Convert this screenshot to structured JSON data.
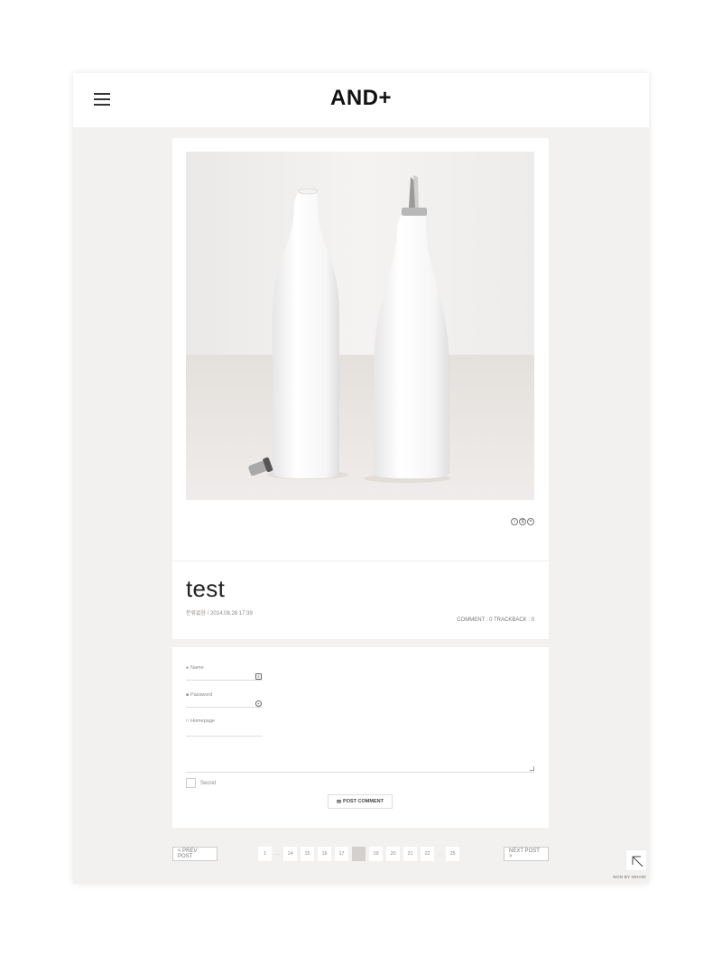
{
  "header": {
    "logo": "AND+"
  },
  "post": {
    "title": "test",
    "category": "분류없음",
    "date": "/ 2014.08.28 17:39",
    "stats": "COMMENT : 0 TRACKBACK : 0",
    "license_icons": [
      "creative-commons-by-icon",
      "creative-commons-nc-icon",
      "creative-commons-nd-icon"
    ]
  },
  "comment_form": {
    "name_label": "Name",
    "password_label": "Password",
    "homepage_label": "Homepage",
    "secret_label": "Secret",
    "submit_label": "POST COMMENT"
  },
  "pager": {
    "prev_label": "< PREV POST",
    "next_label": "NEXT POST >",
    "pages": [
      "1",
      "…",
      "14",
      "15",
      "16",
      "17",
      "18",
      "19",
      "20",
      "21",
      "22",
      "…",
      "25"
    ],
    "current_page": "18"
  },
  "footer": {
    "credit": "SKIN BY ISHAIN"
  },
  "colors": {
    "frame_bg": "#f2f1ef",
    "current_page_bg": "#d3d0cd",
    "category_text": "#9a8f89"
  }
}
